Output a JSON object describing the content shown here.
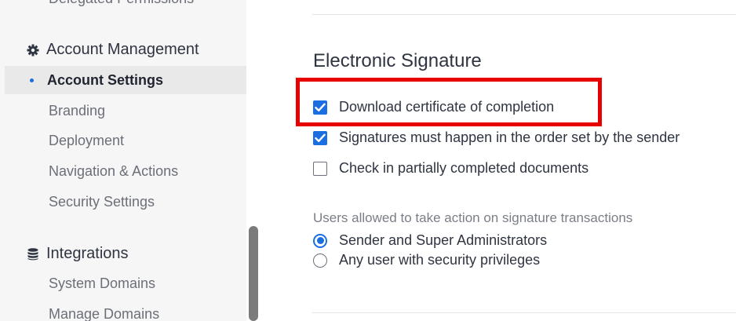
{
  "sidebar": {
    "top_item": "Delegated Permissions",
    "sections": [
      {
        "title": "Account Management",
        "icon": "gear-icon",
        "items": [
          "Account Settings",
          "Branding",
          "Deployment",
          "Navigation & Actions",
          "Security Settings"
        ],
        "active_item": "Account Settings"
      },
      {
        "title": "Integrations",
        "icon": "database-icon",
        "items": [
          "System Domains",
          "Manage Domains"
        ]
      }
    ]
  },
  "main": {
    "title": "Electronic Signature",
    "checkboxes": [
      {
        "label": "Download certificate of completion",
        "checked": true
      },
      {
        "label": "Signatures must happen in the order set by the sender",
        "checked": true
      },
      {
        "label": "Check in partially completed documents",
        "checked": false
      }
    ],
    "radio_group_label": "Users allowed to take action on signature transactions",
    "radios": [
      {
        "label": "Sender and Super Administrators",
        "selected": true
      },
      {
        "label": "Any user with security privileges",
        "selected": false
      }
    ]
  },
  "colors": {
    "accent": "#1a6ee0",
    "highlight_border": "#e60000",
    "sidebar_bg": "#f6f6f6",
    "active_bg": "#e9e9e9"
  }
}
